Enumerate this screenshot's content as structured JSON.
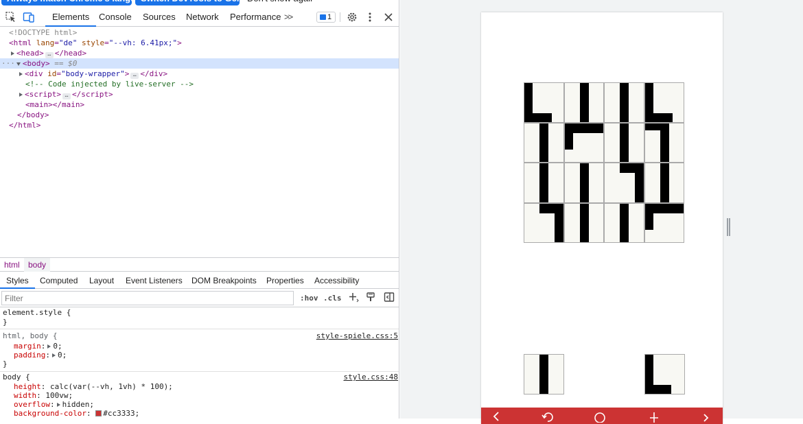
{
  "infobar": {
    "btn_match_language": "Always match Chrome's language",
    "btn_switch_german": "Switch DevTools to German",
    "btn_dont_show": "Don't show again"
  },
  "toolbar": {
    "tabs": [
      "Elements",
      "Console",
      "Sources",
      "Network",
      "Performance"
    ],
    "more_label": ">>",
    "issues_count": "1"
  },
  "elements_tree": {
    "doctype": "<!DOCTYPE html>",
    "html_tag": "html",
    "html_attr_lang": "lang",
    "html_attr_lang_val": "\"de\"",
    "html_attr_style": "style",
    "html_attr_style_val": "\"--vh: 6.41px;\"",
    "head_tag": "head",
    "body_tag": "body",
    "selected_suffix": "== $0",
    "div_tag": "div",
    "div_attr_id": "id",
    "div_attr_id_val": "\"body-wrapper\"",
    "comment": "<!-- Code injected by live-server -->",
    "script_tag": "script",
    "main_tag": "main"
  },
  "breadcrumbs": [
    "html",
    "body"
  ],
  "panel_tabs": [
    "Styles",
    "Computed",
    "Layout",
    "Event Listeners",
    "DOM Breakpoints",
    "Properties",
    "Accessibility"
  ],
  "filter": {
    "placeholder": "Filter",
    "value": "Filter"
  },
  "filter_tools": {
    "hov": ":hov",
    "cls": ".cls"
  },
  "styles": {
    "rule1_selector": "element.style {",
    "close": "}",
    "rule2_selector": "html, body {",
    "rule2_source": "style-spiele.css:5",
    "rule2_p1_name": "margin",
    "rule2_p1_val": "0;",
    "rule2_p2_name": "padding",
    "rule2_p2_val": "0;",
    "rule3_selector": "body {",
    "rule3_source": "style.css:48",
    "rule3_p1_name": "height",
    "rule3_p1_val": "calc(var(--vh, 1vh) * 100);",
    "rule3_p2_name": "width",
    "rule3_p2_val": "100vw;",
    "rule3_p3_name": "overflow",
    "rule3_p3_val": "hidden;",
    "rule3_p4_name": "background-color",
    "rule3_p4_val": "#cc3333;"
  },
  "colors": {
    "accent": "#1a73e8",
    "footer_red": "#cc3333",
    "tile_bg": "#f8f8f3"
  }
}
